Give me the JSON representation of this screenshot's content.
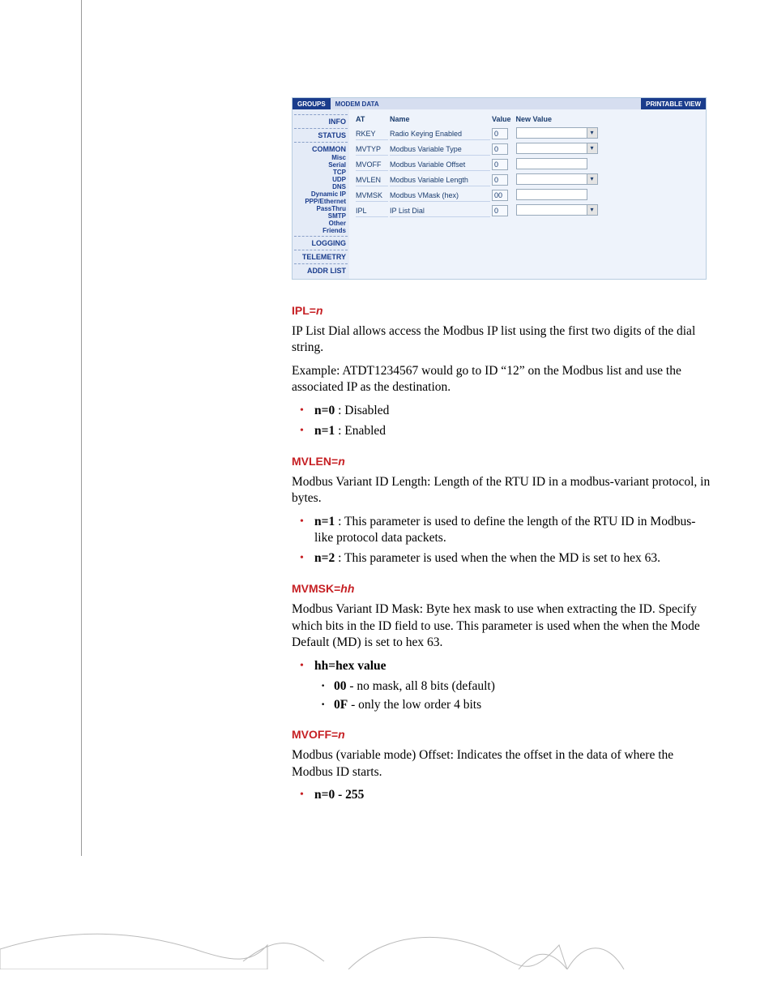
{
  "screenshot": {
    "bar": {
      "groups": "GROUPS",
      "modem": "MODEM DATA",
      "printable": "PRINTABLE VIEW"
    },
    "nav": {
      "info": "INFO",
      "status": "STATUS",
      "common": "COMMON",
      "common_items": [
        "Misc",
        "Serial",
        "TCP",
        "UDP",
        "DNS",
        "Dynamic IP",
        "PPP/Ethernet",
        "PassThru",
        "SMTP",
        "Other",
        "Friends"
      ],
      "logging": "LOGGING",
      "telemetry": "TELEMETRY",
      "addrlist": "ADDR LIST"
    },
    "table": {
      "headers": {
        "at": "AT",
        "name": "Name",
        "value": "Value",
        "newvalue": "New Value"
      },
      "rows": [
        {
          "at": "RKEY",
          "name": "Radio Keying Enabled",
          "value": "0",
          "dropdown": true
        },
        {
          "at": "MVTYP",
          "name": "Modbus Variable Type",
          "value": "0",
          "dropdown": true
        },
        {
          "at": "MVOFF",
          "name": "Modbus Variable Offset",
          "value": "0",
          "dropdown": false
        },
        {
          "at": "MVLEN",
          "name": "Modbus Variable Length",
          "value": "0",
          "dropdown": true
        },
        {
          "at": "MVMSK",
          "name": "Modbus VMask (hex)",
          "value": "00",
          "dropdown": false
        },
        {
          "at": "IPL",
          "name": "IP List Dial",
          "value": "0",
          "dropdown": true
        }
      ]
    }
  },
  "sections": {
    "ipl": {
      "heading_pre": "IPL=",
      "heading_var": "n",
      "p1": "IP List Dial allows access the Modbus IP list using the first two digits of the dial string.",
      "p2": "Example: ATDT1234567 would go to ID “12” on the Modbus list and use the associated IP as the destination.",
      "li1_b": "n=0",
      "li1_t": " : Disabled",
      "li2_b": "n=1",
      "li2_t": " : Enabled"
    },
    "mvlen": {
      "heading_pre": "MVLEN=",
      "heading_var": "n",
      "p1": "Modbus Variant ID Length: Length of the RTU ID in a modbus-variant protocol, in bytes.",
      "li1_b": "n=1",
      "li1_t": " : This parameter is used to define the length of the RTU ID in Modbus-like protocol data packets.",
      "li2_b": "n=2",
      "li2_t": " : This parameter is used when the when the MD is set to hex 63."
    },
    "mvmsk": {
      "heading_pre": "MVMSK=",
      "heading_var": "hh",
      "p1": "Modbus Variant ID Mask: Byte hex mask to use when extracting the ID. Specify which bits in the ID field to use. This parameter is used when the when the Mode Default (MD) is set to hex 63.",
      "li1_b": "hh=hex value",
      "s1_b": "00",
      "s1_t": " - no mask, all 8 bits (default)",
      "s2_b": "0F",
      "s2_t": " - only the low order 4 bits"
    },
    "mvoff": {
      "heading_pre": "MVOFF=",
      "heading_var": "n",
      "p1": "Modbus (variable mode) Offset: Indicates the offset in the data of where the Modbus ID starts.",
      "li1_b": "n=0 - 255"
    }
  }
}
